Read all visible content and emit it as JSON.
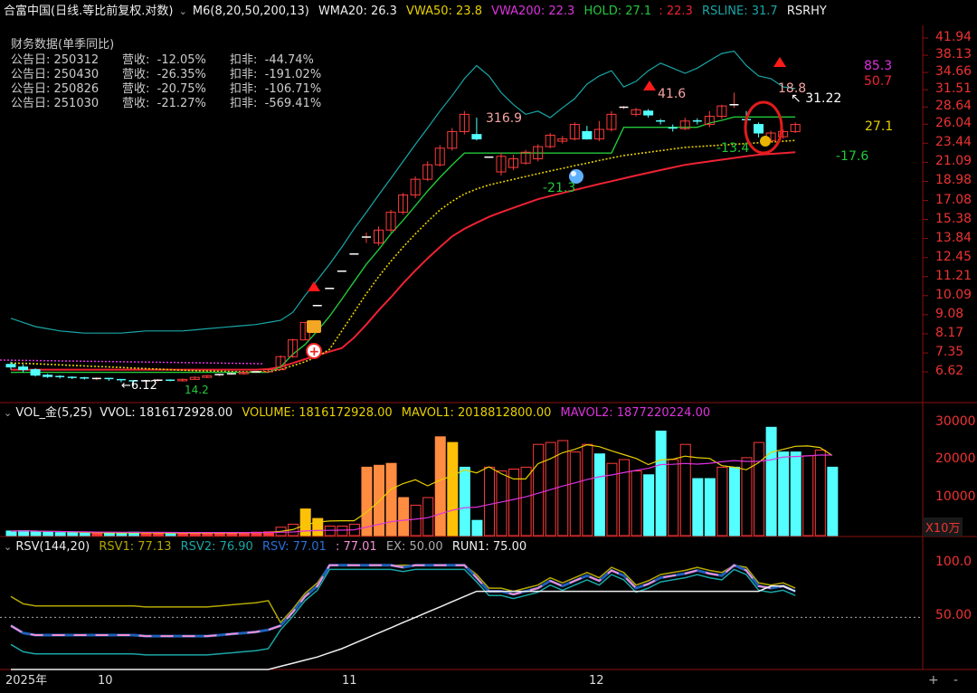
{
  "header": {
    "collapse_icon": "chevron-down-icon",
    "stock": "合富中国(日线.等比前复权.对数)",
    "indicator": "M6(8,20,50,200,13)",
    "wma20": "WMA20: 26.3",
    "vwa50": "VWA50: 23.8",
    "vwa200": "VWA200: 22.3",
    "hold": "HOLD: 27.1",
    "hold2": ": 22.3",
    "rsline": "RSLINE: 31.7",
    "rsrhy": "RSRHY"
  },
  "financial": {
    "title": "财务数据(单季同比)",
    "rows": [
      {
        "date": "公告日: 250312",
        "rev": "营收:  -12.05%",
        "net": "扣非:  -44.74%"
      },
      {
        "date": "公告日: 250430",
        "rev": "营收:  -26.35%",
        "net": "扣非:  -191.02%"
      },
      {
        "date": "公告日: 250826",
        "rev": "营收:  -20.75%",
        "net": "扣非:  -106.71%"
      },
      {
        "date": "公告日: 251030",
        "rev": "营收:  -21.27%",
        "net": "扣非:  -569.41%"
      }
    ]
  },
  "price_axis": [
    "41.94",
    "38.13",
    "34.66",
    "31.51",
    "28.64",
    "26.04",
    "23.44",
    "21.09",
    "18.98",
    "17.08",
    "15.38",
    "13.84",
    "12.45",
    "11.21",
    "10.09",
    "9.08",
    "8.17",
    "7.35",
    "6.62"
  ],
  "annotations": {
    "low": "←6.12",
    "low2": "14.2",
    "a316": "316.9",
    "a41": "41.6",
    "a18": "18.8",
    "a3122": "31.22",
    "a853": "85.3",
    "a507": "50.7",
    "a271": "27.1",
    "a176": "-17.6",
    "a134": "-13.4",
    "a213": "-21.3"
  },
  "volume_header": {
    "collapse_icon": "chevron-down-icon",
    "name": "VOL_金(5,25)",
    "vvol": "VVOL: 1816172928.00",
    "volume": "VOLUME: 1816172928.00",
    "mavol1": "MAVOL1: 2018812800.00",
    "mavol2": "MAVOL2: 1877220224.00"
  },
  "volume_axis": [
    "30000",
    "20000",
    "10000"
  ],
  "volume_unit": "X10万",
  "rsv_header": {
    "collapse_icon": "chevron-down-icon",
    "name": "RSV(144,20)",
    "rsv1": "RSV1: 77.13",
    "rsv2": "RSV2: 76.90",
    "rsv": "RSV: 77.01",
    "rsv_b": ": 77.01",
    "ex": "EX: 50.00",
    "run1": "RUN1: 75.00"
  },
  "rsv_axis": [
    "100.0",
    "50.00"
  ],
  "time_axis": [
    "2025年",
    "10",
    "11",
    "12"
  ],
  "zoom": {
    "plus": "+",
    "minus": "-"
  },
  "colors": {
    "up": "#ff3b3b",
    "down": "#54ffff",
    "ma_green": "#22c83a",
    "ma_red": "#ee2233",
    "ma_yellow": "#e8d000",
    "ma_cyan": "#1aa6a6",
    "magenta": "#dd33dd",
    "bg": "#000000"
  },
  "chart_data": {
    "type": "candlestick",
    "note_scale": "log price",
    "candles": [
      {
        "o": 6.9,
        "c": 6.8,
        "h": 7.0,
        "l": 6.7
      },
      {
        "o": 6.8,
        "c": 6.7,
        "h": 6.9,
        "l": 6.6
      },
      {
        "o": 6.7,
        "c": 6.5,
        "h": 6.75,
        "l": 6.45
      },
      {
        "o": 6.5,
        "c": 6.45,
        "h": 6.55,
        "l": 6.4
      },
      {
        "o": 6.45,
        "c": 6.42,
        "h": 6.5,
        "l": 6.38
      },
      {
        "o": 6.42,
        "c": 6.4,
        "h": 6.46,
        "l": 6.36
      },
      {
        "o": 6.4,
        "c": 6.38,
        "h": 6.44,
        "l": 6.34
      },
      {
        "o": 6.36,
        "c": 6.38,
        "h": 6.42,
        "l": 6.32
      },
      {
        "o": 6.38,
        "c": 6.34,
        "h": 6.4,
        "l": 6.3
      },
      {
        "o": 6.34,
        "c": 6.3,
        "h": 6.36,
        "l": 6.25
      },
      {
        "o": 6.3,
        "c": 6.28,
        "h": 6.32,
        "l": 6.12
      },
      {
        "o": 6.28,
        "c": 6.3,
        "h": 6.34,
        "l": 6.24
      },
      {
        "o": 6.3,
        "c": 6.32,
        "h": 6.36,
        "l": 6.27
      },
      {
        "o": 6.32,
        "c": 6.3,
        "h": 6.35,
        "l": 6.28
      },
      {
        "o": 6.3,
        "c": 6.35,
        "h": 6.38,
        "l": 6.27
      },
      {
        "o": 6.35,
        "c": 6.42,
        "h": 6.45,
        "l": 6.33
      },
      {
        "o": 6.42,
        "c": 6.48,
        "h": 6.5,
        "l": 6.4
      },
      {
        "o": 6.48,
        "c": 6.52,
        "h": 6.55,
        "l": 6.45
      },
      {
        "o": 6.52,
        "c": 6.55,
        "h": 6.58,
        "l": 6.5
      },
      {
        "o": 6.55,
        "c": 6.6,
        "h": 6.63,
        "l": 6.52
      },
      {
        "o": 6.6,
        "c": 6.62,
        "h": 6.66,
        "l": 6.57
      },
      {
        "o": 6.62,
        "c": 6.7,
        "h": 6.74,
        "l": 6.6
      },
      {
        "o": 6.7,
        "c": 7.2,
        "h": 7.25,
        "l": 6.68
      },
      {
        "o": 7.2,
        "c": 7.9,
        "h": 7.95,
        "l": 7.15
      },
      {
        "o": 7.9,
        "c": 8.7,
        "h": 8.7,
        "l": 7.9
      },
      {
        "o": 9.55,
        "c": 9.55,
        "h": 9.55,
        "l": 9.55
      },
      {
        "o": 10.5,
        "c": 10.5,
        "h": 10.5,
        "l": 10.5
      },
      {
        "o": 11.55,
        "c": 11.55,
        "h": 11.55,
        "l": 11.55
      },
      {
        "o": 12.7,
        "c": 12.7,
        "h": 12.7,
        "l": 12.7
      },
      {
        "o": 13.95,
        "c": 13.95,
        "h": 14.3,
        "l": 13.5
      },
      {
        "o": 13.5,
        "c": 14.5,
        "h": 14.8,
        "l": 13.3
      },
      {
        "o": 14.5,
        "c": 16.0,
        "h": 16.2,
        "l": 14.3
      },
      {
        "o": 16.0,
        "c": 17.6,
        "h": 17.8,
        "l": 15.8
      },
      {
        "o": 17.6,
        "c": 19.2,
        "h": 19.5,
        "l": 17.3
      },
      {
        "o": 19.2,
        "c": 20.8,
        "h": 21.2,
        "l": 19.0
      },
      {
        "o": 20.8,
        "c": 22.8,
        "h": 23.2,
        "l": 20.6
      },
      {
        "o": 22.8,
        "c": 25.0,
        "h": 25.5,
        "l": 22.5
      },
      {
        "o": 25.0,
        "c": 27.5,
        "h": 28.0,
        "l": 24.6
      },
      {
        "o": 24.6,
        "c": 24.0,
        "h": 27.0,
        "l": 23.8
      },
      {
        "o": 21.7,
        "c": 21.7,
        "h": 21.7,
        "l": 21.7
      },
      {
        "o": 20.0,
        "c": 21.8,
        "h": 22.2,
        "l": 19.6
      },
      {
        "o": 20.5,
        "c": 21.5,
        "h": 22.0,
        "l": 20.2
      },
      {
        "o": 21.0,
        "c": 22.3,
        "h": 22.6,
        "l": 20.8
      },
      {
        "o": 21.5,
        "c": 23.0,
        "h": 23.3,
        "l": 21.2
      },
      {
        "o": 23.0,
        "c": 24.5,
        "h": 24.8,
        "l": 22.8
      },
      {
        "o": 23.7,
        "c": 24.0,
        "h": 24.4,
        "l": 23.4
      },
      {
        "o": 24.0,
        "c": 26.0,
        "h": 26.3,
        "l": 23.8
      },
      {
        "o": 25.0,
        "c": 24.0,
        "h": 25.8,
        "l": 23.9
      },
      {
        "o": 24.0,
        "c": 25.3,
        "h": 26.5,
        "l": 23.7
      },
      {
        "o": 25.3,
        "c": 27.5,
        "h": 28.0,
        "l": 25.0
      },
      {
        "o": 28.6,
        "c": 28.6,
        "h": 28.8,
        "l": 28.3
      },
      {
        "o": 27.5,
        "c": 28.2,
        "h": 28.5,
        "l": 27.2
      },
      {
        "o": 28.0,
        "c": 27.4,
        "h": 28.3,
        "l": 27.0
      },
      {
        "o": 26.5,
        "c": 26.4,
        "h": 26.8,
        "l": 26.0
      },
      {
        "o": 25.5,
        "c": 25.4,
        "h": 26.0,
        "l": 25.0
      },
      {
        "o": 25.4,
        "c": 26.5,
        "h": 27.0,
        "l": 25.2
      },
      {
        "o": 26.5,
        "c": 26.4,
        "h": 26.9,
        "l": 26.0
      },
      {
        "o": 26.0,
        "c": 27.2,
        "h": 28.0,
        "l": 25.6
      },
      {
        "o": 27.2,
        "c": 28.8,
        "h": 29.0,
        "l": 26.8
      },
      {
        "o": 29.0,
        "c": 29.0,
        "h": 31.0,
        "l": 28.5
      },
      {
        "o": 26.7,
        "c": 26.6,
        "h": 28.0,
        "l": 26.3
      },
      {
        "o": 26.0,
        "c": 24.8,
        "h": 26.3,
        "l": 24.2
      },
      {
        "o": 23.8,
        "c": 24.8,
        "h": 25.1,
        "l": 23.6
      },
      {
        "o": 24.3,
        "c": 25.0,
        "h": 25.3,
        "l": 24.0
      },
      {
        "o": 25.0,
        "c": 26.0,
        "h": 26.3,
        "l": 24.8
      }
    ],
    "hold_line": [
      6.6,
      6.6,
      6.6,
      6.6,
      6.6,
      6.6,
      6.6,
      6.6,
      6.6,
      6.6,
      6.6,
      6.6,
      6.6,
      6.6,
      6.6,
      6.6,
      6.6,
      6.6,
      6.6,
      6.6,
      6.6,
      6.6,
      6.8,
      7.3,
      7.7,
      8.3,
      9.0,
      9.9,
      10.9,
      12.0,
      13.0,
      14.2,
      15.3,
      16.6,
      18.0,
      19.4,
      20.8,
      22.2,
      22.2,
      22.2,
      22.2,
      22.2,
      22.2,
      22.2,
      22.2,
      22.2,
      22.2,
      22.2,
      22.2,
      22.2,
      25.6,
      25.6,
      25.6,
      25.6,
      25.6,
      25.6,
      25.6,
      26.2,
      26.6,
      27.1,
      27.1,
      27.1,
      27.1,
      27.1,
      27.1
    ],
    "vwa50": [
      6.95,
      6.94,
      6.92,
      6.9,
      6.88,
      6.86,
      6.84,
      6.82,
      6.8,
      6.78,
      6.76,
      6.74,
      6.72,
      6.7,
      6.68,
      6.66,
      6.65,
      6.64,
      6.63,
      6.62,
      6.62,
      6.63,
      6.7,
      6.85,
      7.0,
      7.2,
      7.5,
      8.3,
      9.2,
      10.2,
      11.2,
      12.2,
      13.2,
      14.2,
      15.2,
      16.2,
      17.0,
      17.7,
      18.2,
      18.6,
      18.9,
      19.2,
      19.5,
      19.8,
      20.1,
      20.4,
      20.7,
      21.0,
      21.3,
      21.6,
      21.9,
      22.1,
      22.3,
      22.5,
      22.7,
      22.9,
      23.0,
      23.1,
      23.2,
      23.3,
      23.4,
      23.5,
      23.6,
      23.7,
      23.8
    ],
    "vwa200": [
      6.7,
      6.7,
      6.7,
      6.7,
      6.7,
      6.7,
      6.7,
      6.7,
      6.7,
      6.7,
      6.7,
      6.7,
      6.7,
      6.7,
      6.7,
      6.7,
      6.7,
      6.7,
      6.7,
      6.7,
      6.7,
      6.72,
      6.8,
      6.95,
      7.1,
      7.25,
      7.4,
      7.55,
      8.0,
      8.6,
      9.3,
      10.0,
      10.8,
      11.6,
      12.4,
      13.2,
      14.0,
      14.6,
      15.1,
      15.6,
      16.0,
      16.4,
      16.8,
      17.2,
      17.5,
      17.8,
      18.1,
      18.4,
      18.7,
      19.0,
      19.3,
      19.6,
      19.9,
      20.2,
      20.5,
      20.8,
      21.0,
      21.2,
      21.4,
      21.6,
      21.8,
      22.0,
      22.1,
      22.2,
      22.3
    ],
    "rsline": [
      8.9,
      8.7,
      8.5,
      8.4,
      8.3,
      8.25,
      8.2,
      8.2,
      8.2,
      8.2,
      8.25,
      8.3,
      8.3,
      8.3,
      8.3,
      8.35,
      8.4,
      8.45,
      8.5,
      8.55,
      8.6,
      8.7,
      8.8,
      9.2,
      10.1,
      11.0,
      12.0,
      13.2,
      14.6,
      16.0,
      17.6,
      19.3,
      21.2,
      23.3,
      25.5,
      28.0,
      30.5,
      33.5,
      36.0,
      34.0,
      31.0,
      29.0,
      27.5,
      28.0,
      27.0,
      28.5,
      30.0,
      32.5,
      34.0,
      35.0,
      32.0,
      33.0,
      35.0,
      36.5,
      35.5,
      34.5,
      35.5,
      37.0,
      38.5,
      39.0,
      36.0,
      34.0,
      33.5,
      32.0,
      31.7
    ],
    "volume": [
      {
        "v": 1200,
        "up": false
      },
      {
        "v": 1300,
        "up": false
      },
      {
        "v": 1100,
        "up": false
      },
      {
        "v": 900,
        "up": false
      },
      {
        "v": 800,
        "up": false
      },
      {
        "v": 800,
        "up": false
      },
      {
        "v": 700,
        "up": false
      },
      {
        "v": 700,
        "up": true
      },
      {
        "v": 700,
        "up": false
      },
      {
        "v": 700,
        "up": false
      },
      {
        "v": 900,
        "up": false
      },
      {
        "v": 700,
        "up": true
      },
      {
        "v": 600,
        "up": true
      },
      {
        "v": 600,
        "up": false
      },
      {
        "v": 600,
        "up": true
      },
      {
        "v": 700,
        "up": true
      },
      {
        "v": 800,
        "up": true
      },
      {
        "v": 700,
        "up": true
      },
      {
        "v": 700,
        "up": true
      },
      {
        "v": 800,
        "up": true
      },
      {
        "v": 900,
        "up": true
      },
      {
        "v": 1000,
        "up": true
      },
      {
        "v": 2200,
        "up": true
      },
      {
        "v": 3000,
        "up": true
      },
      {
        "v": 7000,
        "up": true,
        "g": "y"
      },
      {
        "v": 4500,
        "up": true,
        "g": "y"
      },
      {
        "v": 2500,
        "up": true
      },
      {
        "v": 2500,
        "up": true
      },
      {
        "v": 3000,
        "up": true
      },
      {
        "v": 18000,
        "up": true,
        "g": "o"
      },
      {
        "v": 18500,
        "up": true,
        "g": "o"
      },
      {
        "v": 19000,
        "up": true,
        "g": "o"
      },
      {
        "v": 10000,
        "up": true,
        "g": "o"
      },
      {
        "v": 8000,
        "up": true
      },
      {
        "v": 10000,
        "up": true
      },
      {
        "v": 26000,
        "up": true,
        "g": "o"
      },
      {
        "v": 24500,
        "up": true,
        "g": "y"
      },
      {
        "v": 18000,
        "up": false
      },
      {
        "v": 4000,
        "up": false
      },
      {
        "v": 18000,
        "up": true
      },
      {
        "v": 17000,
        "up": true
      },
      {
        "v": 17500,
        "up": true
      },
      {
        "v": 18000,
        "up": true
      },
      {
        "v": 24000,
        "up": true
      },
      {
        "v": 24500,
        "up": true
      },
      {
        "v": 25000,
        "up": true
      },
      {
        "v": 22000,
        "up": true
      },
      {
        "v": 24000,
        "up": true
      },
      {
        "v": 21500,
        "up": false
      },
      {
        "v": 19000,
        "up": true
      },
      {
        "v": 20000,
        "up": true
      },
      {
        "v": 17000,
        "up": true
      },
      {
        "v": 16000,
        "up": false
      },
      {
        "v": 27500,
        "up": false
      },
      {
        "v": 20000,
        "up": true
      },
      {
        "v": 24000,
        "up": true
      },
      {
        "v": 15000,
        "up": false
      },
      {
        "v": 15000,
        "up": false
      },
      {
        "v": 18000,
        "up": true
      },
      {
        "v": 18000,
        "up": false
      },
      {
        "v": 20500,
        "up": true
      },
      {
        "v": 24500,
        "up": true
      },
      {
        "v": 28500,
        "up": false
      },
      {
        "v": 22000,
        "up": false
      },
      {
        "v": 22000,
        "up": false
      },
      {
        "v": 21000,
        "up": true
      },
      {
        "v": 22500,
        "up": true
      },
      {
        "v": 18000,
        "up": false
      }
    ],
    "rsv_white": [
      0,
      0,
      0,
      0,
      0,
      0,
      0,
      0,
      0,
      0,
      0,
      0,
      0,
      0,
      0,
      0,
      0,
      0,
      0,
      0,
      0,
      0,
      3,
      6,
      9,
      12,
      16,
      20,
      25,
      30,
      35,
      40,
      45,
      50,
      55,
      60,
      65,
      70,
      75,
      75,
      75,
      75,
      75,
      75,
      75,
      75,
      75,
      75,
      75,
      75,
      75,
      75,
      75,
      75,
      75,
      75,
      75,
      75,
      75,
      75,
      75,
      75,
      80,
      80,
      75
    ],
    "rsv_main": [
      42,
      35,
      33,
      33,
      33,
      33,
      33,
      33,
      33,
      33,
      33,
      32,
      32,
      32,
      32,
      32,
      32,
      33,
      34,
      35,
      36,
      38,
      42,
      55,
      70,
      80,
      100,
      100,
      100,
      100,
      100,
      100,
      98,
      100,
      100,
      100,
      100,
      100,
      88,
      75,
      75,
      72,
      75,
      78,
      85,
      80,
      85,
      90,
      85,
      95,
      90,
      78,
      82,
      88,
      90,
      92,
      95,
      92,
      90,
      100,
      95,
      80,
      78,
      80,
      75
    ]
  }
}
